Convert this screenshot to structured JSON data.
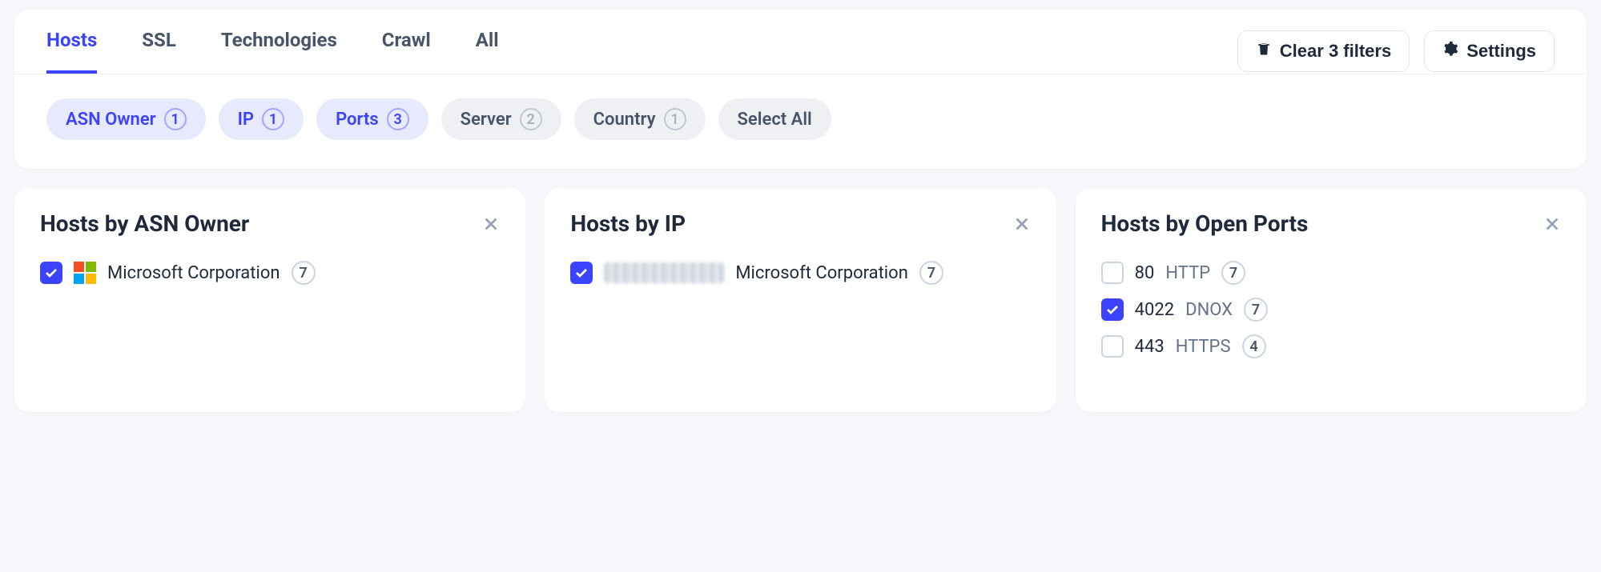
{
  "tabs": [
    {
      "label": "Hosts",
      "active": true
    },
    {
      "label": "SSL",
      "active": false
    },
    {
      "label": "Technologies",
      "active": false
    },
    {
      "label": "Crawl",
      "active": false
    },
    {
      "label": "All",
      "active": false
    }
  ],
  "actions": {
    "clear_filters": "Clear 3 filters",
    "settings": "Settings"
  },
  "chips": [
    {
      "label": "ASN Owner",
      "count": "1",
      "selected": true
    },
    {
      "label": "IP",
      "count": "1",
      "selected": true
    },
    {
      "label": "Ports",
      "count": "3",
      "selected": true
    },
    {
      "label": "Server",
      "count": "2",
      "selected": false
    },
    {
      "label": "Country",
      "count": "1",
      "selected": false
    },
    {
      "label": "Select All",
      "count": null,
      "selected": false
    }
  ],
  "cards": {
    "asn": {
      "title": "Hosts by ASN Owner",
      "items": [
        {
          "checked": true,
          "icon": "microsoft-logo",
          "primary": "Microsoft Corporation",
          "secondary": "",
          "count": "7"
        }
      ]
    },
    "ip": {
      "title": "Hosts by IP",
      "items": [
        {
          "checked": true,
          "icon": "blurred-ip",
          "primary": "",
          "secondary": "Microsoft Corporation",
          "count": "7"
        }
      ]
    },
    "ports": {
      "title": "Hosts by Open Ports",
      "items": [
        {
          "checked": false,
          "primary": "80",
          "secondary": "HTTP",
          "count": "7"
        },
        {
          "checked": true,
          "primary": "4022",
          "secondary": "DNOX",
          "count": "7"
        },
        {
          "checked": false,
          "primary": "443",
          "secondary": "HTTPS",
          "count": "4"
        }
      ]
    }
  }
}
